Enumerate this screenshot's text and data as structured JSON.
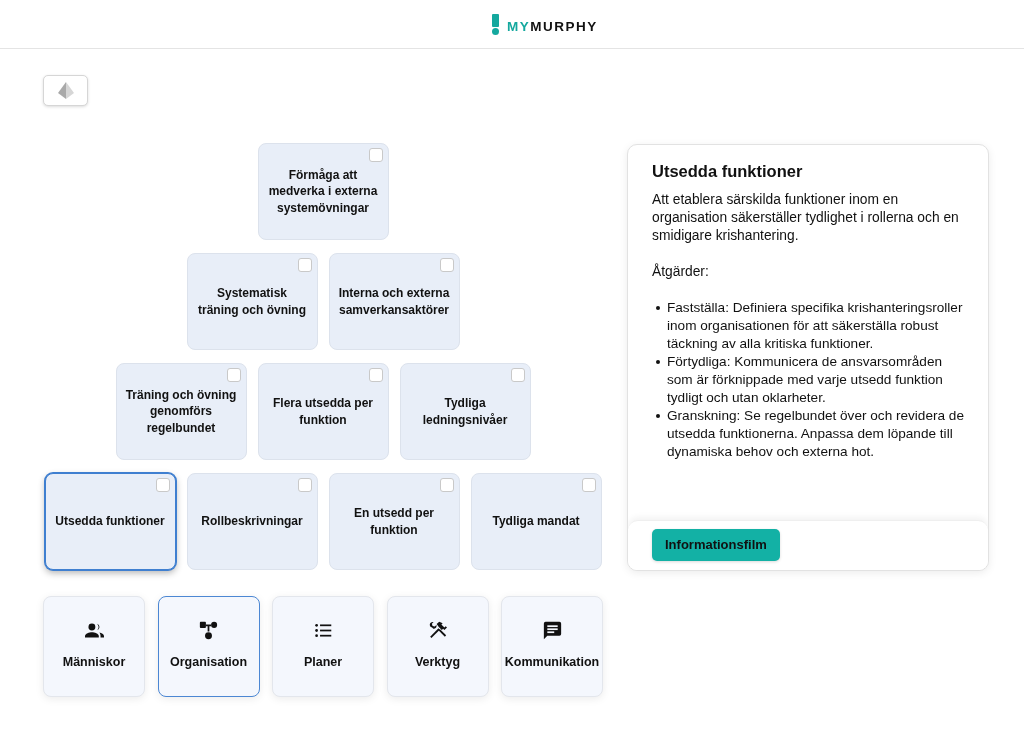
{
  "header": {
    "logo": {
      "accent": "MY",
      "name": "MURPHY"
    }
  },
  "pyramid": {
    "rows": [
      {
        "tiles": [
          {
            "label": "Förmåga att medverka i externa systemövningar",
            "checked": false,
            "selected": false
          }
        ]
      },
      {
        "tiles": [
          {
            "label": "Systematisk träning och övning",
            "checked": false,
            "selected": false
          },
          {
            "label": "Interna och externa samverkansaktörer",
            "checked": false,
            "selected": false
          }
        ]
      },
      {
        "tiles": [
          {
            "label": "Träning och övning genomförs regelbundet",
            "checked": false,
            "selected": false
          },
          {
            "label": "Flera utsedda per funktion",
            "checked": false,
            "selected": false
          },
          {
            "label": "Tydliga ledningsnivåer",
            "checked": false,
            "selected": false
          }
        ]
      },
      {
        "tiles": [
          {
            "label": "Utsedda funktioner",
            "checked": false,
            "selected": true
          },
          {
            "label": "Rollbeskrivningar",
            "checked": false,
            "selected": false
          },
          {
            "label": "En utsedd per funktion",
            "checked": false,
            "selected": false
          },
          {
            "label": "Tydliga mandat",
            "checked": false,
            "selected": false
          }
        ]
      }
    ]
  },
  "categories": [
    {
      "label": "Människor",
      "kind": "people",
      "selected": false
    },
    {
      "label": "Organisation",
      "kind": "hierarchy",
      "selected": true
    },
    {
      "label": "Planer",
      "kind": "list",
      "selected": false
    },
    {
      "label": "Verktyg",
      "kind": "tools",
      "selected": false
    },
    {
      "label": "Kommunikation",
      "kind": "chat",
      "selected": false
    }
  ],
  "detail": {
    "title": "Utsedda funktioner",
    "intro": "Att etablera särskilda funktioner inom en organisation säkerställer tydlighet i rollerna och en smidigare krishantering.",
    "actions_heading": "Åtgärder:",
    "actions": [
      "Fastställa: Definiera specifika krishanteringsroller inom organisationen för att säkerställa robust täckning av alla kritiska funktioner.",
      "Förtydliga: Kommunicera de ansvarsområden som är förknippade med varje utsedd funktion tydligt och utan oklarheter.",
      "Granskning: Se regelbundet över och revidera de utsedda funktionerna. Anpassa dem löpande till dynamiska behov och externa hot."
    ],
    "button": "Informationsfilm"
  }
}
